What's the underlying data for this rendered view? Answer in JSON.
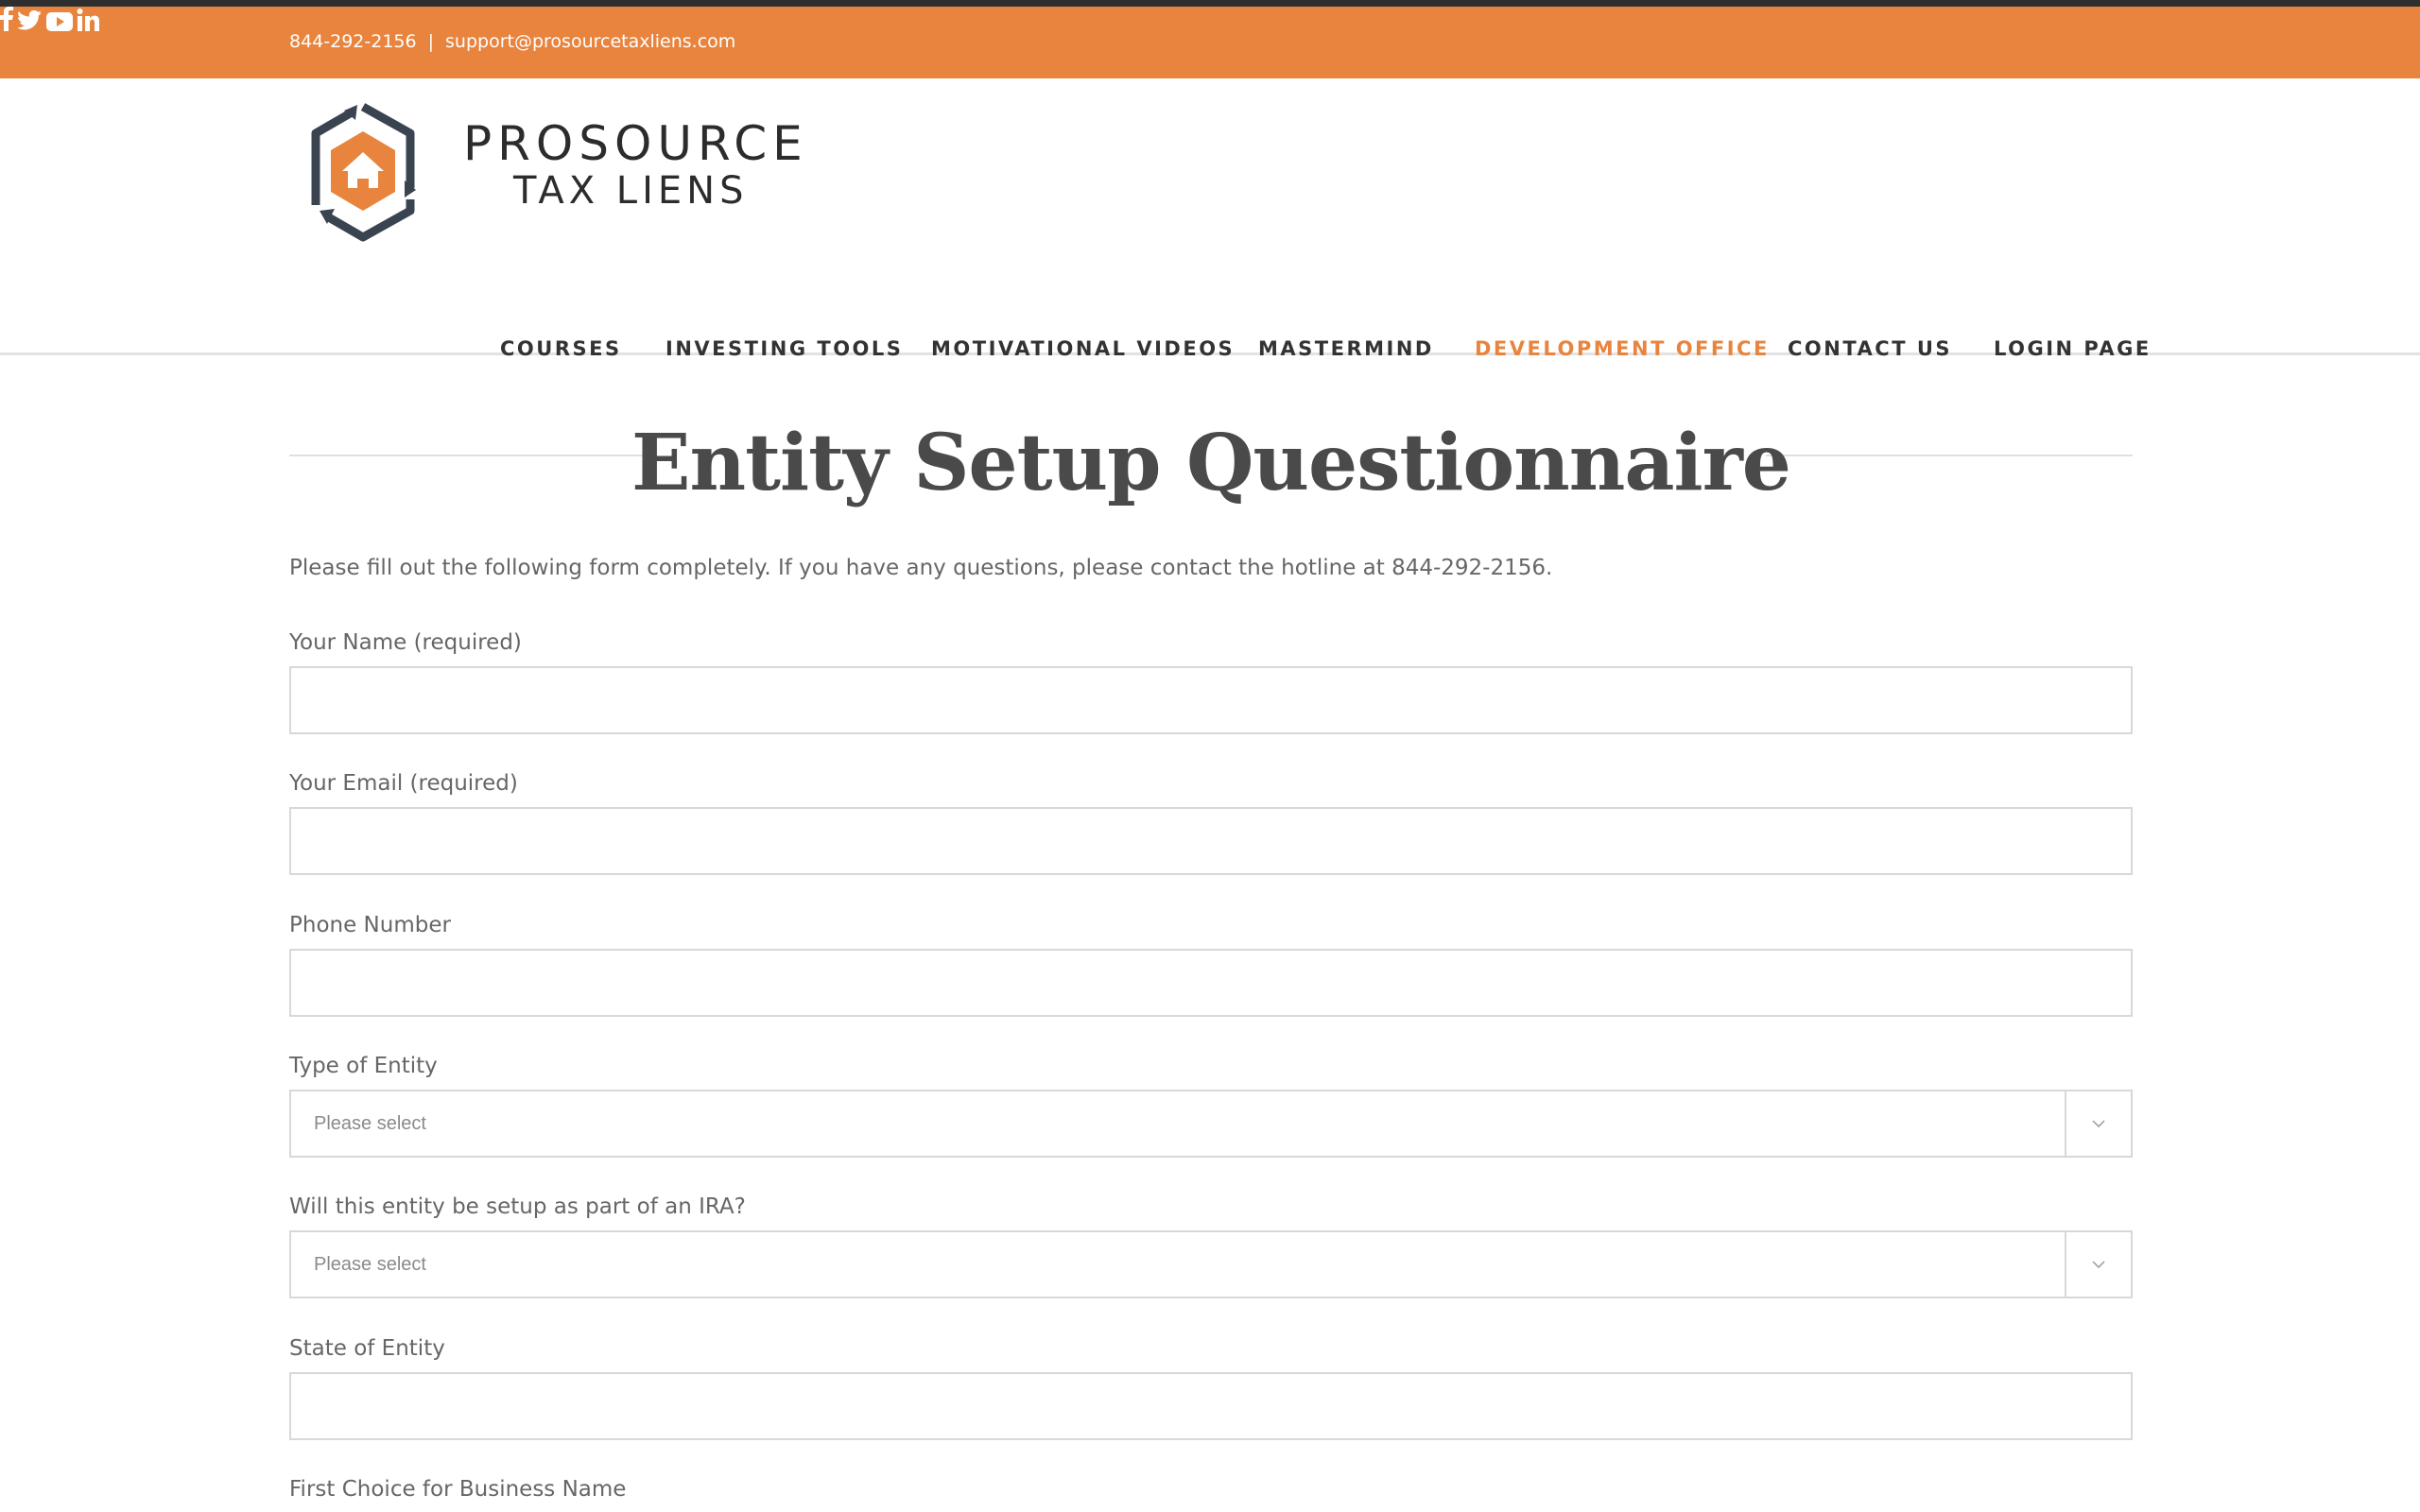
{
  "topbar": {
    "phone": "844-292-2156",
    "separator": "|",
    "email": "support@prosourcetaxliens.com",
    "social": [
      "facebook-icon",
      "twitter-icon",
      "youtube-icon",
      "linkedin-icon"
    ]
  },
  "logo": {
    "line1": "PROSOURCE",
    "line2": "TAX LIENS"
  },
  "nav": {
    "items": [
      "COURSES",
      "INVESTING TOOLS",
      "MOTIVATIONAL VIDEOS",
      "MASTERMIND",
      "DEVELOPMENT OFFICE",
      "CONTACT US",
      "LOGIN PAGE"
    ],
    "active": "DEVELOPMENT OFFICE"
  },
  "page": {
    "title": "Entity Setup Questionnaire",
    "intro": "Please fill out the following form completely. If you have any questions, please contact the hotline at 844-292-2156."
  },
  "form": {
    "name_label": "Your Name (required)",
    "email_label": "Your Email (required)",
    "phone_label": "Phone Number",
    "entity_type_label": "Type of Entity",
    "entity_type_value": "Please select",
    "ira_label": "Will this entity be setup as part of an IRA?",
    "ira_value": "Please select",
    "state_label": "State of Entity",
    "business_name_label": "First Choice for Business Name"
  },
  "colors": {
    "accent": "#e8843d",
    "topline": "#2f2f2f",
    "text": "#4a4a4a"
  }
}
